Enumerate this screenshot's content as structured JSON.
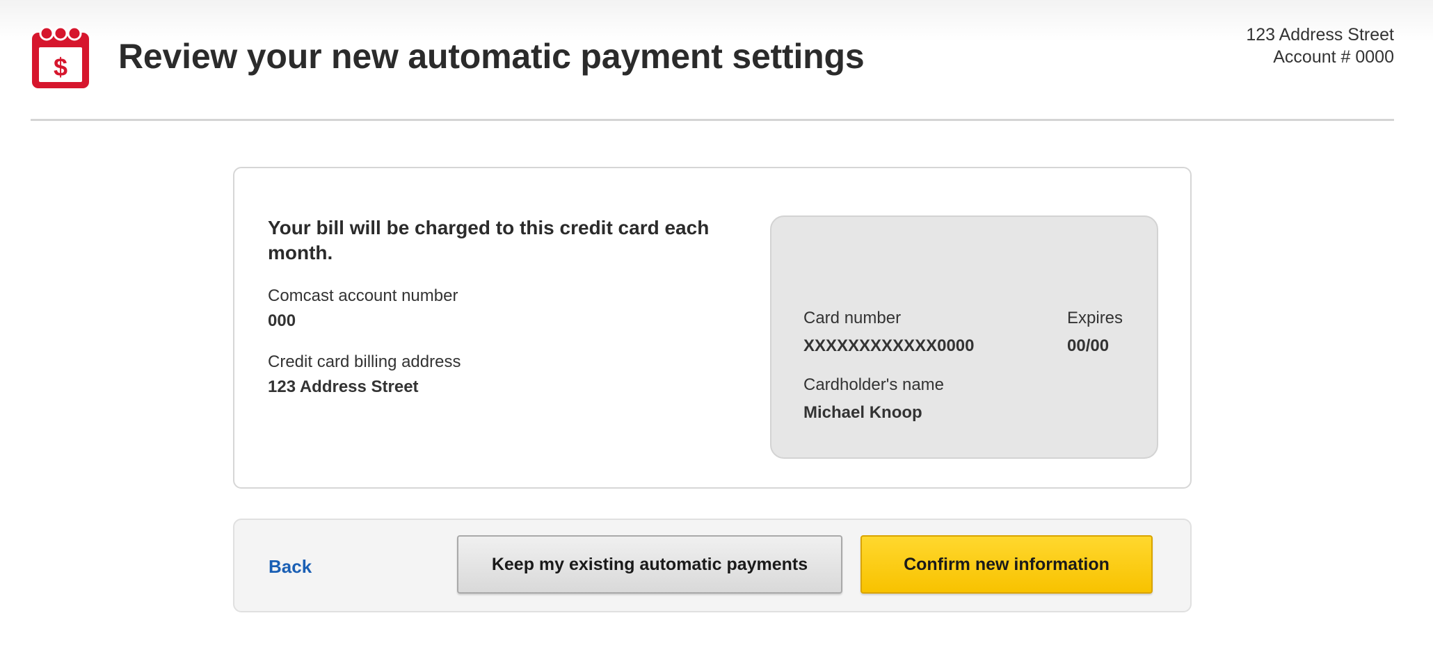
{
  "header": {
    "title": "Review your new automatic payment settings",
    "address": "123 Address Street",
    "account_label": "Account # 0000",
    "icon": "calendar-dollar-icon"
  },
  "summary": {
    "heading": "Your bill will be charged to this credit card each month.",
    "account_number_label": "Comcast account number",
    "account_number_value": "000",
    "billing_address_label": "Credit card billing address",
    "billing_address_value": "123 Address Street"
  },
  "card": {
    "card_number_label": "Card number",
    "card_number_value": "XXXXXXXXXXXX0000",
    "expires_label": "Expires",
    "expires_value": "00/00",
    "cardholder_label": "Cardholder's name",
    "cardholder_value": "Michael Knoop"
  },
  "actions": {
    "back_label": "Back",
    "keep_label": "Keep my existing automatic payments",
    "confirm_label": "Confirm new information"
  },
  "colors": {
    "brand_red": "#d6162d",
    "confirm_yellow": "#fcc800",
    "link_blue": "#1a5fb4"
  }
}
